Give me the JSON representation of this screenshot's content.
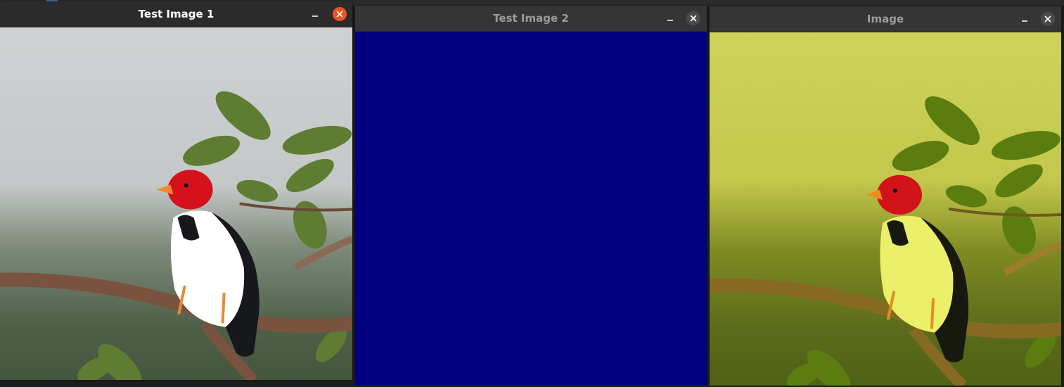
{
  "windows": [
    {
      "title": "Test Image 1",
      "minimize_icon": "minimize-icon",
      "close_icon": "close-icon",
      "content": "bird photo with natural colors"
    },
    {
      "title": "Test Image 2",
      "minimize_icon": "minimize-icon",
      "close_icon": "close-icon",
      "fill_color": "#000080"
    },
    {
      "title": "Image",
      "minimize_icon": "minimize-icon",
      "close_icon": "close-icon",
      "content": "bird photo with yellow tint"
    }
  ],
  "colors": {
    "active_close": "#e95420",
    "inactive_close": "#4a4a4a",
    "titlebar_active": "#2b2b2b",
    "titlebar_inactive": "#353535"
  }
}
